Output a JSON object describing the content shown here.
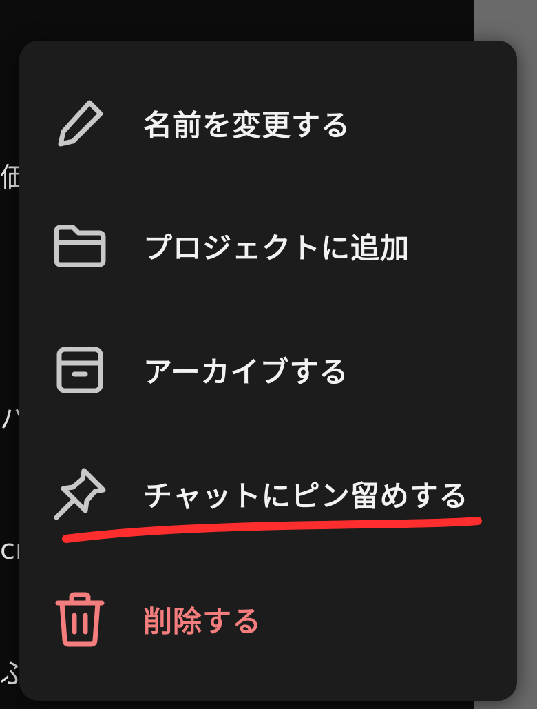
{
  "background": {
    "sidebar_fragments": [
      {
        "id": "frag-1",
        "text": "価"
      },
      {
        "id": "frag-2",
        "text": "バ"
      },
      {
        "id": "frag-3",
        "text": "cr"
      },
      {
        "id": "frag-4",
        "text": "ぶ"
      }
    ]
  },
  "menu": {
    "items": [
      {
        "id": "rename",
        "label": "名前を変更する",
        "icon": "pencil-icon"
      },
      {
        "id": "add-to-project",
        "label": "プロジェクトに追加",
        "icon": "folder-icon"
      },
      {
        "id": "archive",
        "label": "アーカイブする",
        "icon": "archive-box-icon"
      },
      {
        "id": "pin",
        "label": "チャットにピン留めする",
        "icon": "pin-icon"
      },
      {
        "id": "delete",
        "label": "削除する",
        "icon": "trash-icon"
      }
    ]
  },
  "colors": {
    "menu_background": "#1c1c1c",
    "text_primary": "#f2f2f2",
    "icon_color": "#c8c8c8",
    "danger": "#f47d7d",
    "annotation_red": "#ff2e2e"
  }
}
